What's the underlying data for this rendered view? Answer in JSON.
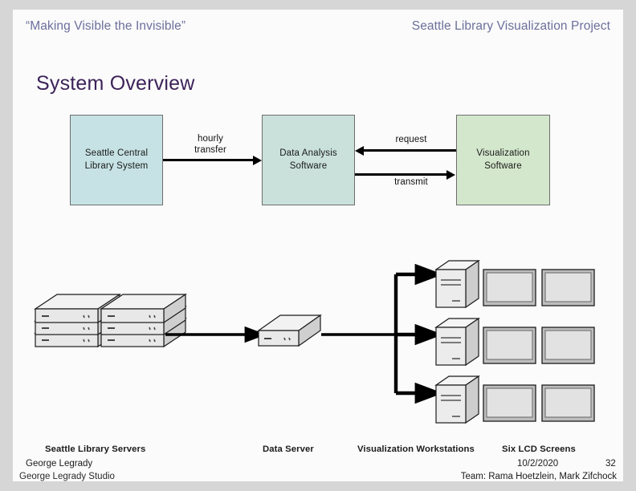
{
  "header": {
    "left": "“Making Visible the Invisible”",
    "right": "Seattle Library Visualization Project"
  },
  "title": "System Overview",
  "flow": {
    "boxes": [
      {
        "name": "library-system",
        "line1": "Seattle Central",
        "line2": "Library System",
        "color": "#c6e2e4"
      },
      {
        "name": "data-analysis",
        "line1": "Data Analysis",
        "line2": "Software",
        "color": "#c9e1da"
      },
      {
        "name": "visualization",
        "line1": "Visualization",
        "line2": "Software",
        "color": "#d3e7cc"
      }
    ],
    "arrows": [
      {
        "name": "hourly-transfer",
        "line1": "hourly",
        "line2": "transfer",
        "direction": "right"
      },
      {
        "name": "request",
        "line1": "request",
        "line2": "",
        "direction": "left"
      },
      {
        "name": "transmit",
        "line1": "transmit",
        "line2": "",
        "direction": "right"
      }
    ]
  },
  "hardware": {
    "captions": [
      {
        "name": "seattle-library-servers",
        "text": "Seattle Library Servers"
      },
      {
        "name": "data-server",
        "text": "Data Server"
      },
      {
        "name": "visualization-workstations",
        "text": "Visualization Workstations"
      },
      {
        "name": "six-lcd-screens",
        "text": "Six  LCD Screens"
      }
    ],
    "server_stack_count": 6,
    "workstation_count": 3,
    "lcd_screen_count": 6
  },
  "footer": {
    "name": "George Legrady",
    "studio": "George Legrady Studio",
    "date": "10/2/2020",
    "page": "32",
    "team": "Team: Rama Hoetzlein, Mark Zifchock"
  },
  "colors": {
    "header_text": "#6c6f9b",
    "title_text": "#3c2359",
    "slide_bg": "#fbfbfb",
    "outer_bg": "#d6d6d6"
  }
}
